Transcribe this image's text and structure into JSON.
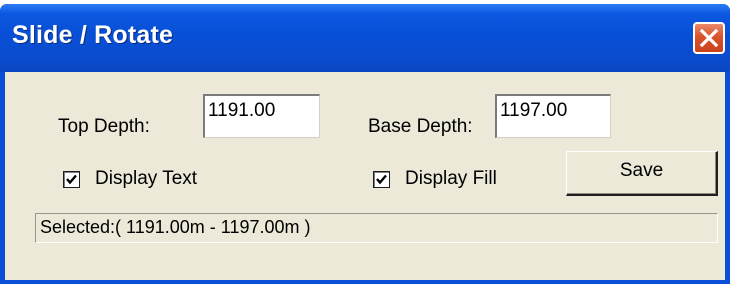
{
  "window": {
    "title": "Slide / Rotate",
    "close_icon": "close-icon"
  },
  "form": {
    "top_depth_label": "Top Depth:",
    "top_depth_value": "1191.00",
    "base_depth_label": "Base Depth:",
    "base_depth_value": "1197.00",
    "display_text_label": "Display Text",
    "display_text_checked": true,
    "display_fill_label": "Display Fill",
    "display_fill_checked": true,
    "save_label": "Save"
  },
  "status": {
    "selected_text": "Selected:( 1191.00m - 1197.00m )"
  },
  "colors": {
    "titlebar": "#0a4fd6",
    "client_background": "#ece9d8",
    "close_button": "#d9532c"
  }
}
